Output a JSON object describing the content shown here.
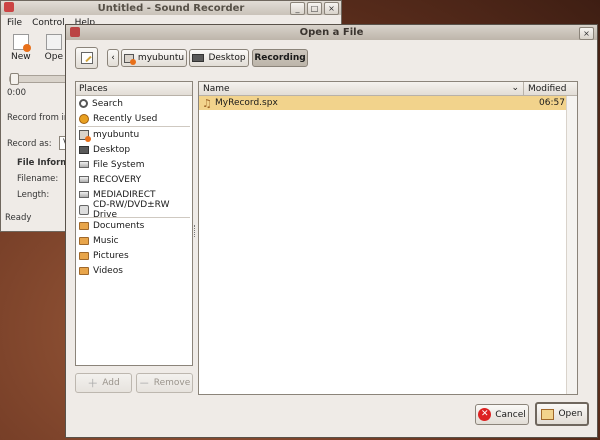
{
  "background_window": {
    "title": "Untitled - Sound Recorder",
    "controls": [
      "_",
      "□",
      "×"
    ],
    "menu": [
      "File",
      "Control",
      "Help"
    ],
    "toolbar": [
      {
        "label": "New"
      },
      {
        "label": "Ope"
      }
    ],
    "time": "0:00",
    "record_from": "Record from in",
    "record_as": "Record as:",
    "record_as_value": "V",
    "file_info_heading": "File Inform",
    "filename_label": "Filename:",
    "length_label": "Length:",
    "status": "Ready"
  },
  "dialog": {
    "title": "Open a File",
    "close": "×",
    "path_back": "‹",
    "path": [
      "myubuntu",
      "Desktop",
      "Recording"
    ],
    "places_header": "Places",
    "places": [
      {
        "label": "Search",
        "icon": "search-icon"
      },
      {
        "label": "Recently Used",
        "icon": "recently-used-icon"
      }
    ],
    "devices": [
      {
        "label": "myubuntu",
        "icon": "home-folder-icon"
      },
      {
        "label": "Desktop",
        "icon": "desktop-icon"
      },
      {
        "label": "File System",
        "icon": "file-system-icon"
      },
      {
        "label": "RECOVERY",
        "icon": "drive-icon"
      },
      {
        "label": "MEDIADIRECT",
        "icon": "drive-icon"
      },
      {
        "label": "CD-RW/DVD±RW Drive",
        "icon": "cd-drive-icon"
      }
    ],
    "bookmarks": [
      {
        "label": "Documents",
        "icon": "folder-icon"
      },
      {
        "label": "Music",
        "icon": "folder-icon"
      },
      {
        "label": "Pictures",
        "icon": "folder-icon"
      },
      {
        "label": "Videos",
        "icon": "folder-icon"
      }
    ],
    "add_label": "Add",
    "remove_label": "Remove",
    "columns": {
      "name": "Name",
      "modified": "Modified",
      "sort_indicator": "⌄"
    },
    "files": [
      {
        "name": "MyRecord.spx",
        "modified": "06:57",
        "selected": true
      }
    ],
    "cancel_label": "Cancel",
    "open_label": "Open"
  }
}
